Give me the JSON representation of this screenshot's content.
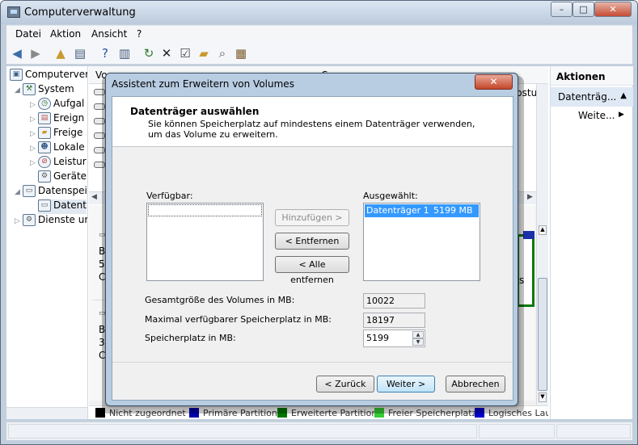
{
  "window": {
    "title": "Computerverwaltung",
    "controls": [
      "–",
      "□",
      "✕"
    ]
  },
  "menu": [
    "Datei",
    "Aktion",
    "Ansicht",
    "?"
  ],
  "tree": {
    "items": [
      {
        "label": "Computerverwa",
        "depth": 0,
        "expand": ""
      },
      {
        "label": "System",
        "depth": 1,
        "expand": "◢"
      },
      {
        "label": "Aufgal",
        "depth": 2,
        "expand": "▷"
      },
      {
        "label": "Ereign",
        "depth": 2,
        "expand": "▷"
      },
      {
        "label": "Freige",
        "depth": 2,
        "expand": "▷"
      },
      {
        "label": "Lokale",
        "depth": 2,
        "expand": "▷"
      },
      {
        "label": "Leistur",
        "depth": 2,
        "expand": "▷"
      },
      {
        "label": "Geräte",
        "depth": 2,
        "expand": ""
      },
      {
        "label": "Datenspei",
        "depth": 1,
        "expand": "◢"
      },
      {
        "label": "Datent",
        "depth": 2,
        "expand": ""
      },
      {
        "label": "Dienste ur",
        "depth": 1,
        "expand": "▷"
      }
    ]
  },
  "list": {
    "header_first": "Vo",
    "header_mid": "S",
    "cut_text": "bsturz",
    "graph_letters_1": [
      "B",
      "5",
      "C"
    ],
    "graph_letters_2": [
      "B",
      "3",
      "C"
    ],
    "graph_right_letter": "s"
  },
  "legend": [
    {
      "label": "Nicht zugeordnet",
      "color": "#000000"
    },
    {
      "label": "Primäre Partition",
      "color": "#0000aa"
    },
    {
      "label": "Erweiterte Partition",
      "color": "#007700"
    },
    {
      "label": "Freier Speicherplatz",
      "color": "#33cc33"
    },
    {
      "label": "Logisches Lau",
      "color": "#0000cc"
    }
  ],
  "actions": {
    "header": "Aktionen",
    "selected": "Datenträg...",
    "item": "Weite..."
  },
  "dialog": {
    "title": "Assistent zum Erweitern von Volumes",
    "heading": "Datenträger auswählen",
    "subheading": "Sie können Speicherplatz auf mindestens einem Datenträger verwenden, um das Volume zu erweitern.",
    "available_label": "Verfügbar:",
    "selected_label": "Ausgewählt:",
    "selected_items": [
      {
        "name": "Datenträger 1",
        "size": "5199 MB"
      }
    ],
    "btn_add": "Hinzufügen >",
    "btn_remove": "< Entfernen",
    "btn_remove_all": "< Alle entfernen",
    "total_label": "Gesamtgröße des Volumes in MB:",
    "total_value": "10022",
    "max_label": "Maximal verfügbarer Speicherplatz in MB:",
    "max_value": "18197",
    "space_label": "Speicherplatz in MB:",
    "space_value": "5199",
    "btn_back": "< Zurück",
    "btn_next": "Weiter >",
    "btn_cancel": "Abbrechen"
  }
}
